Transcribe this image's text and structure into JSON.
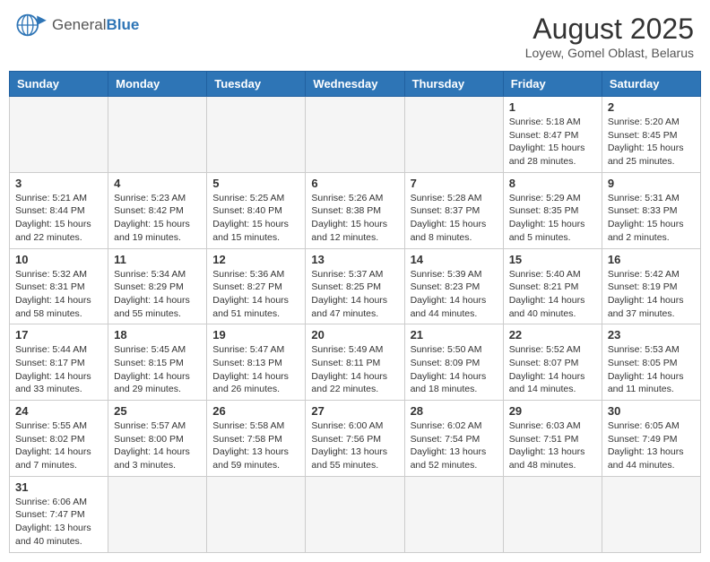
{
  "header": {
    "logo_general": "General",
    "logo_blue": "Blue",
    "month_title": "August 2025",
    "subtitle": "Loyew, Gomel Oblast, Belarus"
  },
  "days_of_week": [
    "Sunday",
    "Monday",
    "Tuesday",
    "Wednesday",
    "Thursday",
    "Friday",
    "Saturday"
  ],
  "weeks": [
    [
      {
        "day": "",
        "info": ""
      },
      {
        "day": "",
        "info": ""
      },
      {
        "day": "",
        "info": ""
      },
      {
        "day": "",
        "info": ""
      },
      {
        "day": "",
        "info": ""
      },
      {
        "day": "1",
        "info": "Sunrise: 5:18 AM\nSunset: 8:47 PM\nDaylight: 15 hours\nand 28 minutes."
      },
      {
        "day": "2",
        "info": "Sunrise: 5:20 AM\nSunset: 8:45 PM\nDaylight: 15 hours\nand 25 minutes."
      }
    ],
    [
      {
        "day": "3",
        "info": "Sunrise: 5:21 AM\nSunset: 8:44 PM\nDaylight: 15 hours\nand 22 minutes."
      },
      {
        "day": "4",
        "info": "Sunrise: 5:23 AM\nSunset: 8:42 PM\nDaylight: 15 hours\nand 19 minutes."
      },
      {
        "day": "5",
        "info": "Sunrise: 5:25 AM\nSunset: 8:40 PM\nDaylight: 15 hours\nand 15 minutes."
      },
      {
        "day": "6",
        "info": "Sunrise: 5:26 AM\nSunset: 8:38 PM\nDaylight: 15 hours\nand 12 minutes."
      },
      {
        "day": "7",
        "info": "Sunrise: 5:28 AM\nSunset: 8:37 PM\nDaylight: 15 hours\nand 8 minutes."
      },
      {
        "day": "8",
        "info": "Sunrise: 5:29 AM\nSunset: 8:35 PM\nDaylight: 15 hours\nand 5 minutes."
      },
      {
        "day": "9",
        "info": "Sunrise: 5:31 AM\nSunset: 8:33 PM\nDaylight: 15 hours\nand 2 minutes."
      }
    ],
    [
      {
        "day": "10",
        "info": "Sunrise: 5:32 AM\nSunset: 8:31 PM\nDaylight: 14 hours\nand 58 minutes."
      },
      {
        "day": "11",
        "info": "Sunrise: 5:34 AM\nSunset: 8:29 PM\nDaylight: 14 hours\nand 55 minutes."
      },
      {
        "day": "12",
        "info": "Sunrise: 5:36 AM\nSunset: 8:27 PM\nDaylight: 14 hours\nand 51 minutes."
      },
      {
        "day": "13",
        "info": "Sunrise: 5:37 AM\nSunset: 8:25 PM\nDaylight: 14 hours\nand 47 minutes."
      },
      {
        "day": "14",
        "info": "Sunrise: 5:39 AM\nSunset: 8:23 PM\nDaylight: 14 hours\nand 44 minutes."
      },
      {
        "day": "15",
        "info": "Sunrise: 5:40 AM\nSunset: 8:21 PM\nDaylight: 14 hours\nand 40 minutes."
      },
      {
        "day": "16",
        "info": "Sunrise: 5:42 AM\nSunset: 8:19 PM\nDaylight: 14 hours\nand 37 minutes."
      }
    ],
    [
      {
        "day": "17",
        "info": "Sunrise: 5:44 AM\nSunset: 8:17 PM\nDaylight: 14 hours\nand 33 minutes."
      },
      {
        "day": "18",
        "info": "Sunrise: 5:45 AM\nSunset: 8:15 PM\nDaylight: 14 hours\nand 29 minutes."
      },
      {
        "day": "19",
        "info": "Sunrise: 5:47 AM\nSunset: 8:13 PM\nDaylight: 14 hours\nand 26 minutes."
      },
      {
        "day": "20",
        "info": "Sunrise: 5:49 AM\nSunset: 8:11 PM\nDaylight: 14 hours\nand 22 minutes."
      },
      {
        "day": "21",
        "info": "Sunrise: 5:50 AM\nSunset: 8:09 PM\nDaylight: 14 hours\nand 18 minutes."
      },
      {
        "day": "22",
        "info": "Sunrise: 5:52 AM\nSunset: 8:07 PM\nDaylight: 14 hours\nand 14 minutes."
      },
      {
        "day": "23",
        "info": "Sunrise: 5:53 AM\nSunset: 8:05 PM\nDaylight: 14 hours\nand 11 minutes."
      }
    ],
    [
      {
        "day": "24",
        "info": "Sunrise: 5:55 AM\nSunset: 8:02 PM\nDaylight: 14 hours\nand 7 minutes."
      },
      {
        "day": "25",
        "info": "Sunrise: 5:57 AM\nSunset: 8:00 PM\nDaylight: 14 hours\nand 3 minutes."
      },
      {
        "day": "26",
        "info": "Sunrise: 5:58 AM\nSunset: 7:58 PM\nDaylight: 13 hours\nand 59 minutes."
      },
      {
        "day": "27",
        "info": "Sunrise: 6:00 AM\nSunset: 7:56 PM\nDaylight: 13 hours\nand 55 minutes."
      },
      {
        "day": "28",
        "info": "Sunrise: 6:02 AM\nSunset: 7:54 PM\nDaylight: 13 hours\nand 52 minutes."
      },
      {
        "day": "29",
        "info": "Sunrise: 6:03 AM\nSunset: 7:51 PM\nDaylight: 13 hours\nand 48 minutes."
      },
      {
        "day": "30",
        "info": "Sunrise: 6:05 AM\nSunset: 7:49 PM\nDaylight: 13 hours\nand 44 minutes."
      }
    ],
    [
      {
        "day": "31",
        "info": "Sunrise: 6:06 AM\nSunset: 7:47 PM\nDaylight: 13 hours\nand 40 minutes."
      },
      {
        "day": "",
        "info": ""
      },
      {
        "day": "",
        "info": ""
      },
      {
        "day": "",
        "info": ""
      },
      {
        "day": "",
        "info": ""
      },
      {
        "day": "",
        "info": ""
      },
      {
        "day": "",
        "info": ""
      }
    ]
  ]
}
